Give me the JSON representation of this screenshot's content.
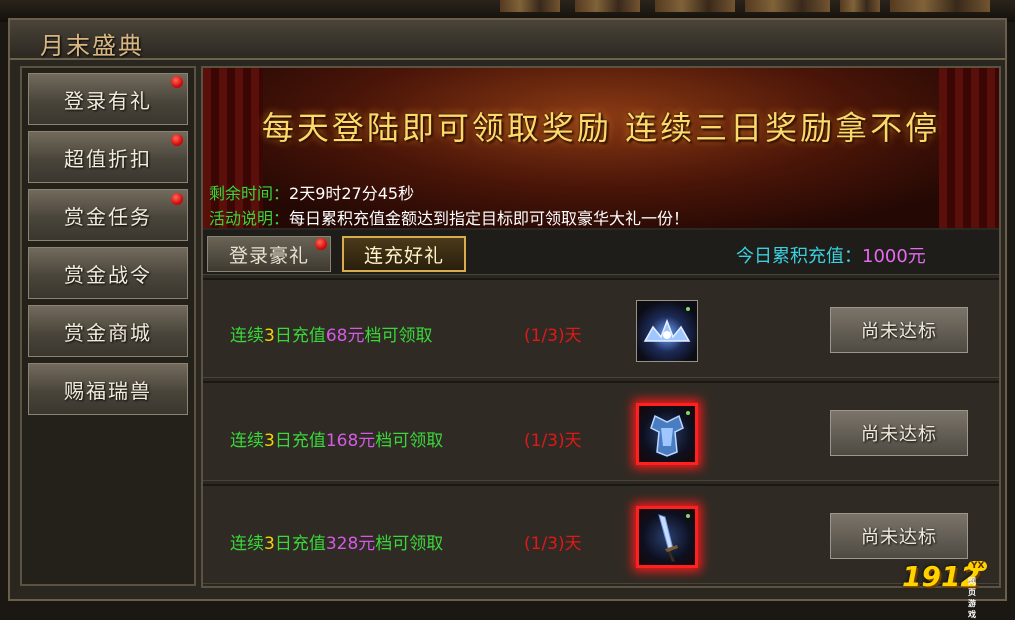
{
  "window": {
    "title": "月末盛典"
  },
  "sidebar": {
    "items": [
      {
        "label": "登录有礼",
        "badge": true
      },
      {
        "label": "超值折扣",
        "badge": true
      },
      {
        "label": "赏金任务",
        "badge": true
      },
      {
        "label": "赏金战令",
        "badge": false
      },
      {
        "label": "赏金商城",
        "badge": false
      },
      {
        "label": "赐福瑞兽",
        "badge": false
      }
    ]
  },
  "banner": {
    "headline": "每天登陆即可领取奖励 连续三日奖励拿不停",
    "remaining_label": "剩余时间：",
    "remaining_value": "2天9时27分45秒",
    "desc_label": "活动说明：",
    "desc_value": "每日累积充值金额达到指定目标即可领取豪华大礼一份！"
  },
  "tabs": [
    {
      "label": "登录豪礼",
      "badge": true,
      "selected": false
    },
    {
      "label": "连充好礼",
      "badge": false,
      "selected": true
    }
  ],
  "daily_total": {
    "label": "今日累积充值：",
    "value": "1000元"
  },
  "rewards": [
    {
      "prefix": "连续",
      "days": "3",
      "mid": "日充值",
      "amount": "68元",
      "suffix": "档可领取",
      "progress": "(1/3)天",
      "button": "尚未达标",
      "icon": "crown-item-icon"
    },
    {
      "prefix": "连续",
      "days": "3",
      "mid": "日充值",
      "amount": "168元",
      "suffix": "档可领取",
      "progress": "(1/3)天",
      "button": "尚未达标",
      "icon": "armor-item-icon"
    },
    {
      "prefix": "连续",
      "days": "3",
      "mid": "日充值",
      "amount": "328元",
      "suffix": "档可领取",
      "progress": "(1/3)天",
      "button": "尚未达标",
      "icon": "sword-item-icon"
    }
  ],
  "watermark": {
    "text": "1912",
    "badge": "YX",
    "sub": "网页游戏"
  },
  "colors": {
    "highlight_green": "#3bd63b",
    "highlight_yellow": "#f5d500",
    "amount_purple": "#d45ae6",
    "progress_red": "#e01818",
    "badge_red": "#d60d0d"
  }
}
